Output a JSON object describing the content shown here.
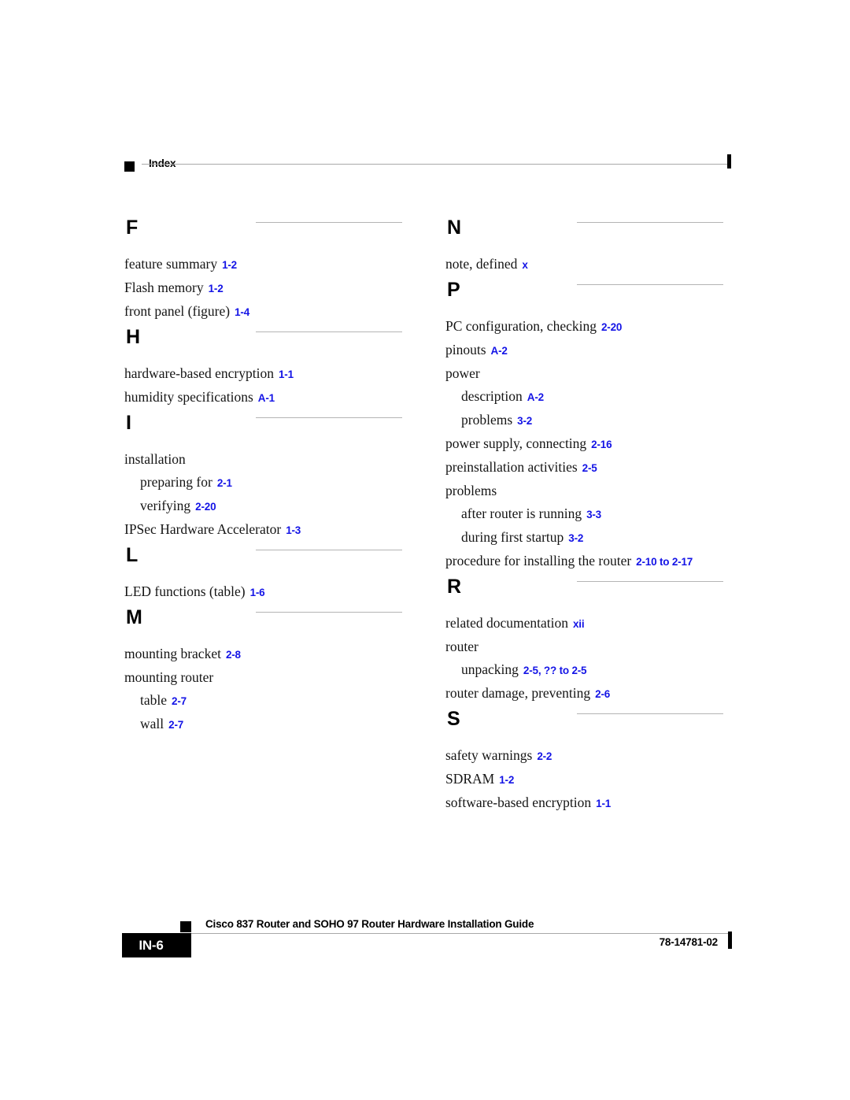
{
  "header": {
    "title": "Index",
    "square_icon": "black-square-bullet"
  },
  "columns": [
    {
      "side": "left",
      "sections": [
        {
          "letter": "F",
          "entries": [
            {
              "level": 1,
              "text": "feature summary",
              "ref": "1-2"
            },
            {
              "level": 1,
              "text": "Flash memory",
              "ref": "1-2"
            },
            {
              "level": 1,
              "text": "front panel (figure)",
              "ref": "1-4"
            }
          ]
        },
        {
          "letter": "H",
          "entries": [
            {
              "level": 1,
              "text": "hardware-based encryption",
              "ref": "1-1"
            },
            {
              "level": 1,
              "text": "humidity specifications",
              "ref": "A-1"
            }
          ]
        },
        {
          "letter": "I",
          "entries": [
            {
              "level": 1,
              "text": "installation",
              "ref": ""
            },
            {
              "level": 2,
              "text": "preparing for",
              "ref": "2-1"
            },
            {
              "level": 2,
              "text": "verifying",
              "ref": "2-20"
            },
            {
              "level": 1,
              "text": "IPSec Hardware Accelerator",
              "ref": "1-3"
            }
          ]
        },
        {
          "letter": "L",
          "entries": [
            {
              "level": 1,
              "text": "LED functions (table)",
              "ref": "1-6"
            }
          ]
        },
        {
          "letter": "M",
          "entries": [
            {
              "level": 1,
              "text": "mounting bracket",
              "ref": "2-8"
            },
            {
              "level": 1,
              "text": "mounting router",
              "ref": ""
            },
            {
              "level": 2,
              "text": "table",
              "ref": "2-7"
            },
            {
              "level": 2,
              "text": "wall",
              "ref": "2-7"
            }
          ]
        }
      ]
    },
    {
      "side": "right",
      "sections": [
        {
          "letter": "N",
          "entries": [
            {
              "level": 1,
              "text": "note, defined",
              "ref": "x"
            }
          ]
        },
        {
          "letter": "P",
          "entries": [
            {
              "level": 1,
              "text": "PC configuration, checking",
              "ref": "2-20"
            },
            {
              "level": 1,
              "text": "pinouts",
              "ref": "A-2"
            },
            {
              "level": 1,
              "text": "power",
              "ref": ""
            },
            {
              "level": 2,
              "text": "description",
              "ref": "A-2"
            },
            {
              "level": 2,
              "text": "problems",
              "ref": "3-2"
            },
            {
              "level": 1,
              "text": "power supply, connecting",
              "ref": "2-16"
            },
            {
              "level": 1,
              "text": "preinstallation activities",
              "ref": "2-5"
            },
            {
              "level": 1,
              "text": "problems",
              "ref": ""
            },
            {
              "level": 2,
              "text": "after router is running",
              "ref": "3-3"
            },
            {
              "level": 2,
              "text": "during first startup",
              "ref": "3-2"
            },
            {
              "level": 1,
              "text": "procedure for installing the router",
              "ref": "2-10 to 2-17"
            }
          ]
        },
        {
          "letter": "R",
          "entries": [
            {
              "level": 1,
              "text": "related documentation",
              "ref": "xii"
            },
            {
              "level": 1,
              "text": "router",
              "ref": ""
            },
            {
              "level": 2,
              "text": "unpacking",
              "ref": "2-5, ?? to 2-5"
            },
            {
              "level": 1,
              "text": "router damage, preventing",
              "ref": "2-6"
            }
          ]
        },
        {
          "letter": "S",
          "entries": [
            {
              "level": 1,
              "text": "safety warnings",
              "ref": "2-2"
            },
            {
              "level": 1,
              "text": "SDRAM",
              "ref": "1-2"
            },
            {
              "level": 1,
              "text": "software-based encryption",
              "ref": "1-1"
            }
          ]
        }
      ]
    }
  ],
  "footer": {
    "page_number": "IN-6",
    "guide_title": "Cisco 837 Router and SOHO 97 Router Hardware Installation Guide",
    "doc_number": "78-14781-02"
  },
  "colors": {
    "reference_blue": "#1414e6",
    "rule_gray": "#a8a8a8",
    "text_black": "#151515"
  }
}
